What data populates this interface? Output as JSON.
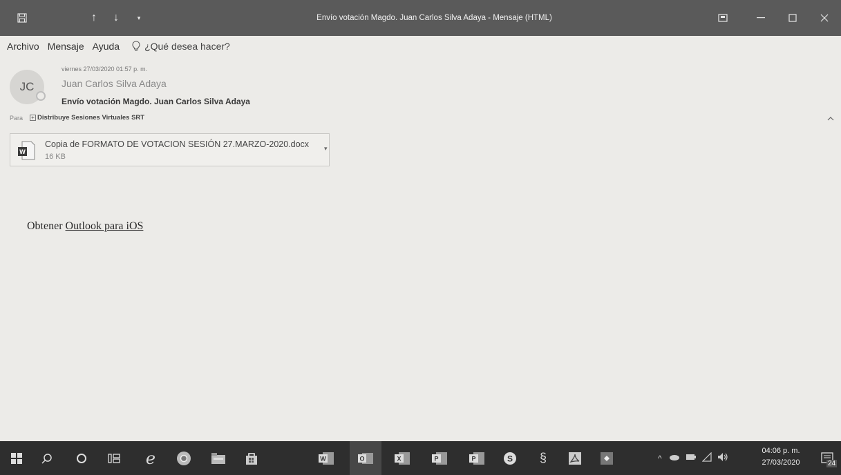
{
  "window": {
    "title": "Envío votación Magdo. Juan Carlos Silva Adaya  -  Mensaje (HTML)"
  },
  "menu": {
    "items": [
      "Archivo",
      "Mensaje",
      "Ayuda"
    ],
    "tell_me": "¿Qué desea hacer?"
  },
  "message": {
    "avatar_initials": "JC",
    "date": "viernes 27/03/2020 01:57 p. m.",
    "from": "Juan Carlos Silva Adaya",
    "subject": "Envío votación Magdo. Juan Carlos Silva Adaya",
    "to_label": "Para",
    "to_name": "Distribuye Sesiones Virtuales SRT",
    "attachment": {
      "name": "Copia de FORMATO DE VOTACION SESIÓN 27.MARZO-2020.docx",
      "size": "16 KB",
      "icon": "word-document-icon"
    },
    "body_prefix": "Obtener",
    "body_link": "Outlook para iOS"
  },
  "taskbar": {
    "apps": [
      "windows-start-icon",
      "search-icon",
      "cortana-icon",
      "task-view-icon",
      "edge-icon",
      "chrome-icon",
      "file-explorer-icon",
      "store-icon",
      "word-icon",
      "outlook-icon",
      "excel-icon",
      "powerpoint-icon",
      "project-icon",
      "skype-icon",
      "anydesk-icon",
      "acrobat-icon",
      "remote-icon"
    ],
    "clock_time": "04:06 p. m.",
    "clock_date": "27/03/2020",
    "notification_count": "24"
  }
}
